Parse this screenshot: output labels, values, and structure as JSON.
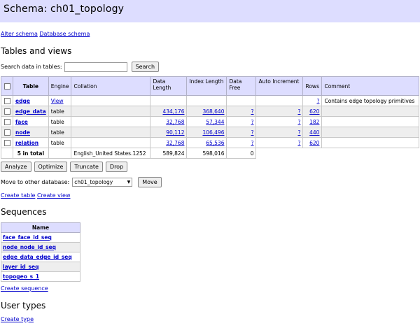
{
  "header": {
    "title": "Schema: ch01_topology"
  },
  "top_links": {
    "alter": "Alter schema",
    "db_schema": "Database schema"
  },
  "tables_section": {
    "heading": "Tables and views",
    "search_label": "Search data in tables:",
    "search_value": "",
    "search_button": "Search",
    "columns": [
      "Table",
      "Engine",
      "Collation",
      "Data Length",
      "Index Length",
      "Data Free",
      "Auto Increment",
      "Rows",
      "Comment"
    ],
    "rows": [
      {
        "name": "edge",
        "engine": "View",
        "engine_link": true,
        "collation": "",
        "data_length": "",
        "index_length": "",
        "data_free": "",
        "auto_inc": "",
        "rows": "?",
        "comment": "Contains edge topology primitives"
      },
      {
        "name": "edge_data",
        "engine": "table",
        "engine_link": false,
        "collation": "",
        "data_length": "434,176",
        "index_length": "368,640",
        "data_free": "?",
        "auto_inc": "?",
        "rows": "620",
        "comment": ""
      },
      {
        "name": "face",
        "engine": "table",
        "engine_link": false,
        "collation": "",
        "data_length": "32,768",
        "index_length": "57,344",
        "data_free": "?",
        "auto_inc": "?",
        "rows": "182",
        "comment": ""
      },
      {
        "name": "node",
        "engine": "table",
        "engine_link": false,
        "collation": "",
        "data_length": "90,112",
        "index_length": "106,496",
        "data_free": "?",
        "auto_inc": "?",
        "rows": "440",
        "comment": ""
      },
      {
        "name": "relation",
        "engine": "table",
        "engine_link": false,
        "collation": "",
        "data_length": "32,768",
        "index_length": "65,536",
        "data_free": "?",
        "auto_inc": "?",
        "rows": "620",
        "comment": ""
      }
    ],
    "total": {
      "label": "5 in total",
      "collation": "English_United States.1252",
      "data_length": "589,824",
      "index_length": "598,016",
      "data_free": "0"
    },
    "action_buttons": [
      "Analyze",
      "Optimize",
      "Truncate",
      "Drop"
    ],
    "move_label": "Move to other database:",
    "move_selected": "ch01_topology",
    "move_button": "Move",
    "create_table": "Create table",
    "create_view": "Create view"
  },
  "sequences_section": {
    "heading": "Sequences",
    "column": "Name",
    "items": [
      "face_face_id_seq",
      "node_node_id_seq",
      "edge_data_edge_id_seq",
      "layer_id_seq",
      "topogeo_s_1"
    ],
    "create": "Create sequence"
  },
  "user_types_section": {
    "heading": "User types",
    "create": "Create type"
  }
}
